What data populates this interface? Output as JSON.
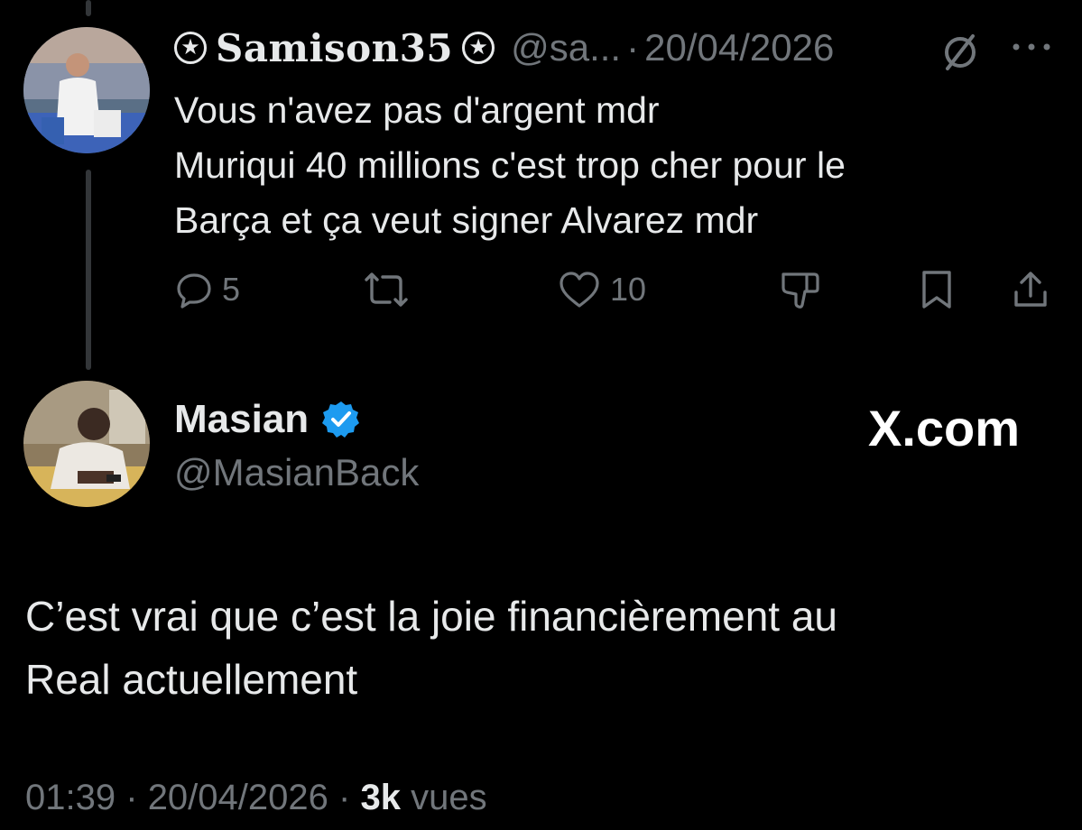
{
  "reply": {
    "display_name": "Samison35",
    "handle": "@sa...",
    "separator": "·",
    "date": "20/04/2026",
    "text_lines": [
      "Vous n'avez pas d'argent mdr",
      "Muriqui 40 millions c'est trop cher pour le",
      "Barça et ça veut signer Alvarez mdr"
    ],
    "actions": {
      "reply_count": "5",
      "repost_count": "",
      "like_count": "10"
    }
  },
  "main": {
    "display_name": "Masian",
    "handle": "@MasianBack",
    "watermark": "X.com",
    "text_lines": [
      "C’est vrai que c’est la joie financièrement au",
      "Real actuellement"
    ],
    "time": "01:39",
    "separator": "·",
    "date": "20/04/2026",
    "views_count": "3k",
    "views_label": "vues"
  },
  "colors": {
    "background": "#000000",
    "text": "#e7e9ea",
    "muted": "#71767b",
    "verified": "#1d9bf0"
  },
  "icons": [
    "star-icon",
    "grok-icon",
    "more-icon",
    "reply-icon",
    "repost-icon",
    "like-icon",
    "dislike-icon",
    "bookmark-icon",
    "share-icon",
    "verified-badge-icon"
  ]
}
